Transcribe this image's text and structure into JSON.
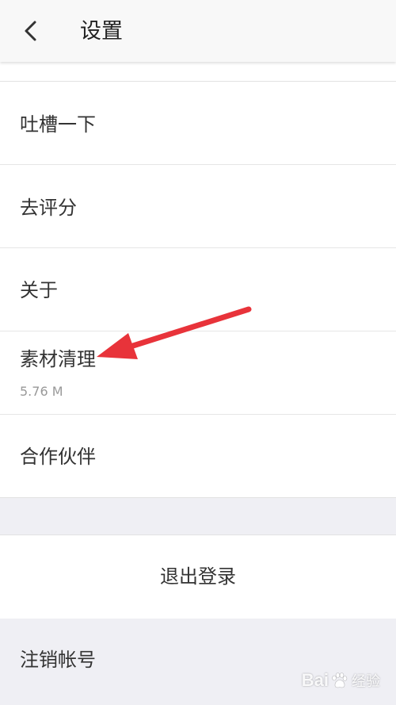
{
  "header": {
    "title": "设置",
    "back_icon": "chevron-left-icon"
  },
  "settings_list": {
    "items": [
      {
        "label": "吐槽一下"
      },
      {
        "label": "去评分"
      },
      {
        "label": "关于"
      },
      {
        "label": "素材清理",
        "subtext": "5.76 M"
      },
      {
        "label": "合作伙伴"
      }
    ]
  },
  "logout": {
    "label": "退出登录"
  },
  "cancel_account": {
    "label": "注销帐号"
  },
  "annotation": {
    "color": "#e8333a"
  },
  "watermark": {
    "logo_left": "Bai",
    "logo_right": "",
    "text": "经验"
  }
}
